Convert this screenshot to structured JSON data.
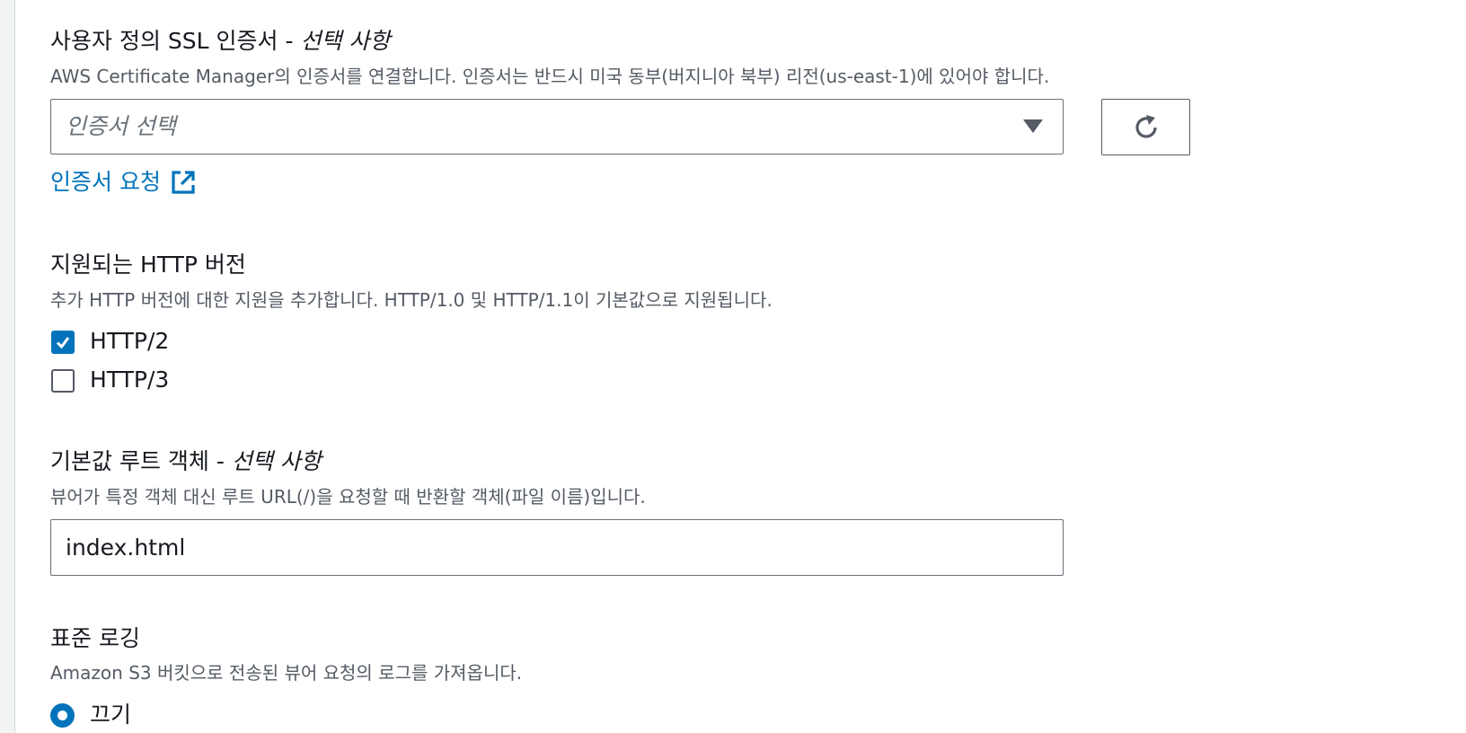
{
  "ssl": {
    "label": "사용자 정의 SSL 인증서 - ",
    "label_optional": "선택 사항",
    "description": "AWS Certificate Manager의 인증서를 연결합니다. 인증서는 반드시 미국 동부(버지니아 북부) 리전(us-east-1)에 있어야 합니다.",
    "select_placeholder": "인증서 선택",
    "request_link": "인증서 요청"
  },
  "http_version": {
    "label": "지원되는 HTTP 버전",
    "description": "추가 HTTP 버전에 대한 지원을 추가합니다. HTTP/1.0 및 HTTP/1.1이 기본값으로 지원됩니다.",
    "options": [
      {
        "label": "HTTP/2",
        "checked": true
      },
      {
        "label": "HTTP/3",
        "checked": false
      }
    ]
  },
  "default_root": {
    "label": "기본값 루트 객체 - ",
    "label_optional": "선택 사항",
    "description": "뷰어가 특정 객체 대신 루트 URL(/)을 요청할 때 반환할 객체(파일 이름)입니다.",
    "value": "index.html"
  },
  "logging": {
    "label": "표준 로깅",
    "description": "Amazon S3 버킷으로 전송된 뷰어 요청의 로그를 가져옵니다.",
    "option_off": "끄기"
  },
  "colors": {
    "accent": "#0073bb",
    "text": "#16191f",
    "muted": "#545b64"
  }
}
